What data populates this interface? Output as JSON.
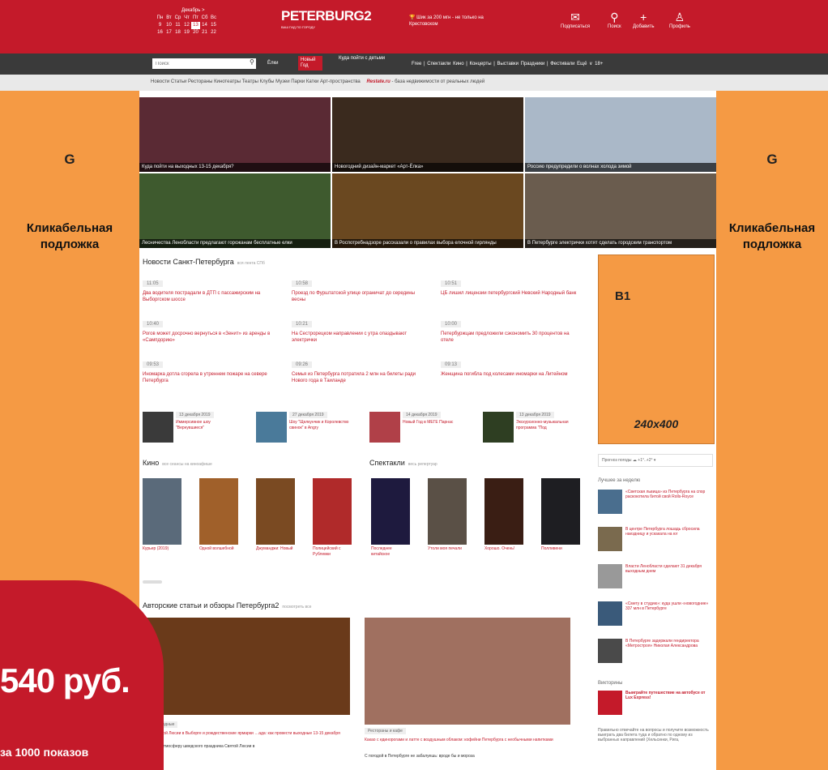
{
  "colors": {
    "brand_red": "#c41a2a",
    "nav_dark": "#3a3a3a",
    "orange": "#f59a44"
  },
  "side_left": {
    "letter": "G",
    "label": "Кликабельная подложка"
  },
  "side_right": {
    "letter": "G",
    "label": "Кликабельная подложка"
  },
  "calendar": {
    "month": "Декабрь >",
    "days": [
      "Пн",
      "Вт",
      "Ср",
      "Чт",
      "Пт",
      "Сб",
      "Вс"
    ],
    "row1": [
      "9",
      "10",
      "11",
      "12",
      "13",
      "14",
      "15"
    ],
    "row2": [
      "16",
      "17",
      "18",
      "19",
      "20",
      "21",
      "22"
    ]
  },
  "logo": {
    "text": "PETERBURG2",
    "tagline": "ВАШ ГИД ПО ГОРОДУ"
  },
  "promo": "Шик за 200 мгн - не только на Крестовском",
  "topicons": [
    {
      "icon": "envelope-icon",
      "label": "Подписаться"
    },
    {
      "icon": "search-icon",
      "label": "Поиск"
    },
    {
      "icon": "plus-icon",
      "label": "Добавить"
    },
    {
      "icon": "user-icon",
      "label": "Профиль"
    }
  ],
  "nav": {
    "search_placeholder": "Поиск",
    "elki": "Ёлки",
    "newyear": "Новый Год",
    "kuda": "Куда пойти с детьми",
    "right": "Free | Спектакли  Кино | Концерты | Выставки  Праздники | Фестивали  Ещё ∨  18+"
  },
  "subnav": {
    "items": "Новости  Статьи  Рестораны  Кинотеатры  Театры  Клубы  Музеи  Парки  Катки  Арт-пространства",
    "estate_logo": "Restate.ru",
    "estate_text": " - база недвижимости от реальных людей"
  },
  "tiles": [
    {
      "caption": "Куда пойти на выходных 13-15 декабря?",
      "color": "#5a2a34"
    },
    {
      "caption": "Новогодний дизайн-маркет «Арт-Ёлка»",
      "color": "#3a2a1e"
    },
    {
      "caption": "Россию предупредили о волнах холода зимой",
      "color": "#aab8c8"
    },
    {
      "caption": "Лесничества Ленобласти предлагают горожанам бесплатные елки",
      "color": "#3e5a2e"
    },
    {
      "caption": "В Роспотребнадзоре рассказали о правилах выбора елочной гирлянды",
      "color": "#6a4820"
    },
    {
      "caption": "В Петербурге электрички хотят сделать городским транспортом",
      "color": "#6a5c4e"
    }
  ],
  "news": {
    "title": "Новости Санкт-Петербурга",
    "more": "вся лента СПб",
    "items": [
      {
        "time": "11:05",
        "text": "Два водителя пострадали в ДТП с пассажирским на Выборгском шоссе"
      },
      {
        "time": "10:58",
        "text": "Проезд по Фурштатской улице ограничат до середины весны"
      },
      {
        "time": "10:51",
        "text": "ЦБ лишил лицензии петербургский Невский Народный банк"
      },
      {
        "time": "10:40",
        "text": "Рогов может досрочно вернуться в «Зенит» из аренды в «Сампдорию»"
      },
      {
        "time": "10:21",
        "text": "На Сестрорецком направлении с утра опаздывают электрички"
      },
      {
        "time": "10:00",
        "text": "Петербуржцам предложили сэкономить 30 процентов на отеле"
      },
      {
        "time": "09:53",
        "text": "Иномарка дотла сгорела в утреннем пожаре на севере Петербурга"
      },
      {
        "time": "09:26",
        "text": "Семья из Петербурга потратила 2 млн на билеты ради Нового года в Таиланде"
      },
      {
        "time": "09:13",
        "text": "Женщина погибла под колесами иномарки на Литейном"
      }
    ]
  },
  "events": [
    {
      "date": "13 декабря 2019",
      "title": "Иммерсивное шоу \"Вернувшиеся\"",
      "color": "#3a3a3a"
    },
    {
      "date": "27 декабря 2019",
      "title": "Шоу \"Щелкунчик и Королевство свинок\" в Angry",
      "color": "#4a7a9a"
    },
    {
      "date": "14 декабря 2019",
      "title": "Новый Год в МЕГЕ Парнас",
      "color": "#b04048"
    },
    {
      "date": "13 декабря 2019",
      "title": "Экскурсионно-музыкальная программа \"Под",
      "color": "#2e3e22"
    }
  ],
  "kino": {
    "title": "Кино",
    "more": "все сеансы на киноафише",
    "items": [
      {
        "title": "Курьер (2019)",
        "color": "#5a6a7a"
      },
      {
        "title": "Одной волшебной",
        "color": "#a0602a"
      },
      {
        "title": "Джуманджи: Новый",
        "color": "#7a4a22"
      },
      {
        "title": "Полицейский с Рублевки",
        "color": "#b02a2a"
      }
    ]
  },
  "spekt": {
    "title": "Спектакли",
    "more": "весь репертуар",
    "items": [
      {
        "title": "Последнее китайское",
        "color": "#1e1a3e"
      },
      {
        "title": "Утоли моя печали",
        "color": "#5a5046"
      },
      {
        "title": "Хорошо. Очень!",
        "color": "#3a1e14"
      },
      {
        "title": "Полливени",
        "color": "#1e1e22"
      }
    ]
  },
  "b1": {
    "label": "B1",
    "size": "240x400"
  },
  "weather": "Прогноз погоды  ☁ +1°..+2° ▾",
  "best": {
    "title": "Лучшее за неделю",
    "items": [
      {
        "text": "«Светская львица» из Петербурга на спор раскокотила битой свой Rolls-Royce",
        "color": "#4a6e8e"
      },
      {
        "text": "В центре Петербурга лошадь сбросила наездницу и ускакала на юг",
        "color": "#7a6a4e"
      },
      {
        "text": "Власти Ленобласти сделают 31 декабря выходным днем",
        "color": "#999999"
      },
      {
        "text": "«Смету в студию»: куда ушли «новогодние» 337 млн в Петербурге",
        "color": "#3a5a7a"
      },
      {
        "text": "В Петербурге задержали гендиректора «Метростроя» Николая Александрова",
        "color": "#4a4a4a"
      }
    ]
  },
  "quiz": {
    "title": "Викторины",
    "headline": "Выиграйте путешествие на автобусе от Lux Express!",
    "text": "Правильно отвечайте на вопросы и получите возможность выиграть два билета туда и обратно по одному из выбранных направлений (Хельсинки, Рига,"
  },
  "articles": {
    "title": "Авторские статьи и обзоры Петербурга2",
    "more": "посмотреть все",
    "items": [
      {
        "tag": "…на выходные",
        "title": "…ник Святой Люсии в Выборге и рождественские ярмарки …ада: как провести выходные 13-15 декабря",
        "text": "…уться в атмосферу шведского праздника Святой Люсии в",
        "color": "#6a3a1a"
      },
      {
        "tag": "Рестораны и кафе",
        "title": "Какао с единорогами и латте с воздушным облаком: кофейни Петербурга с необычными напитками",
        "text": "С погодой в Петербурге не забалуешь: вроде бы и мороза",
        "color": "#a07060"
      }
    ]
  },
  "price": {
    "big": "540 руб.",
    "small": "за 1000 показов"
  }
}
